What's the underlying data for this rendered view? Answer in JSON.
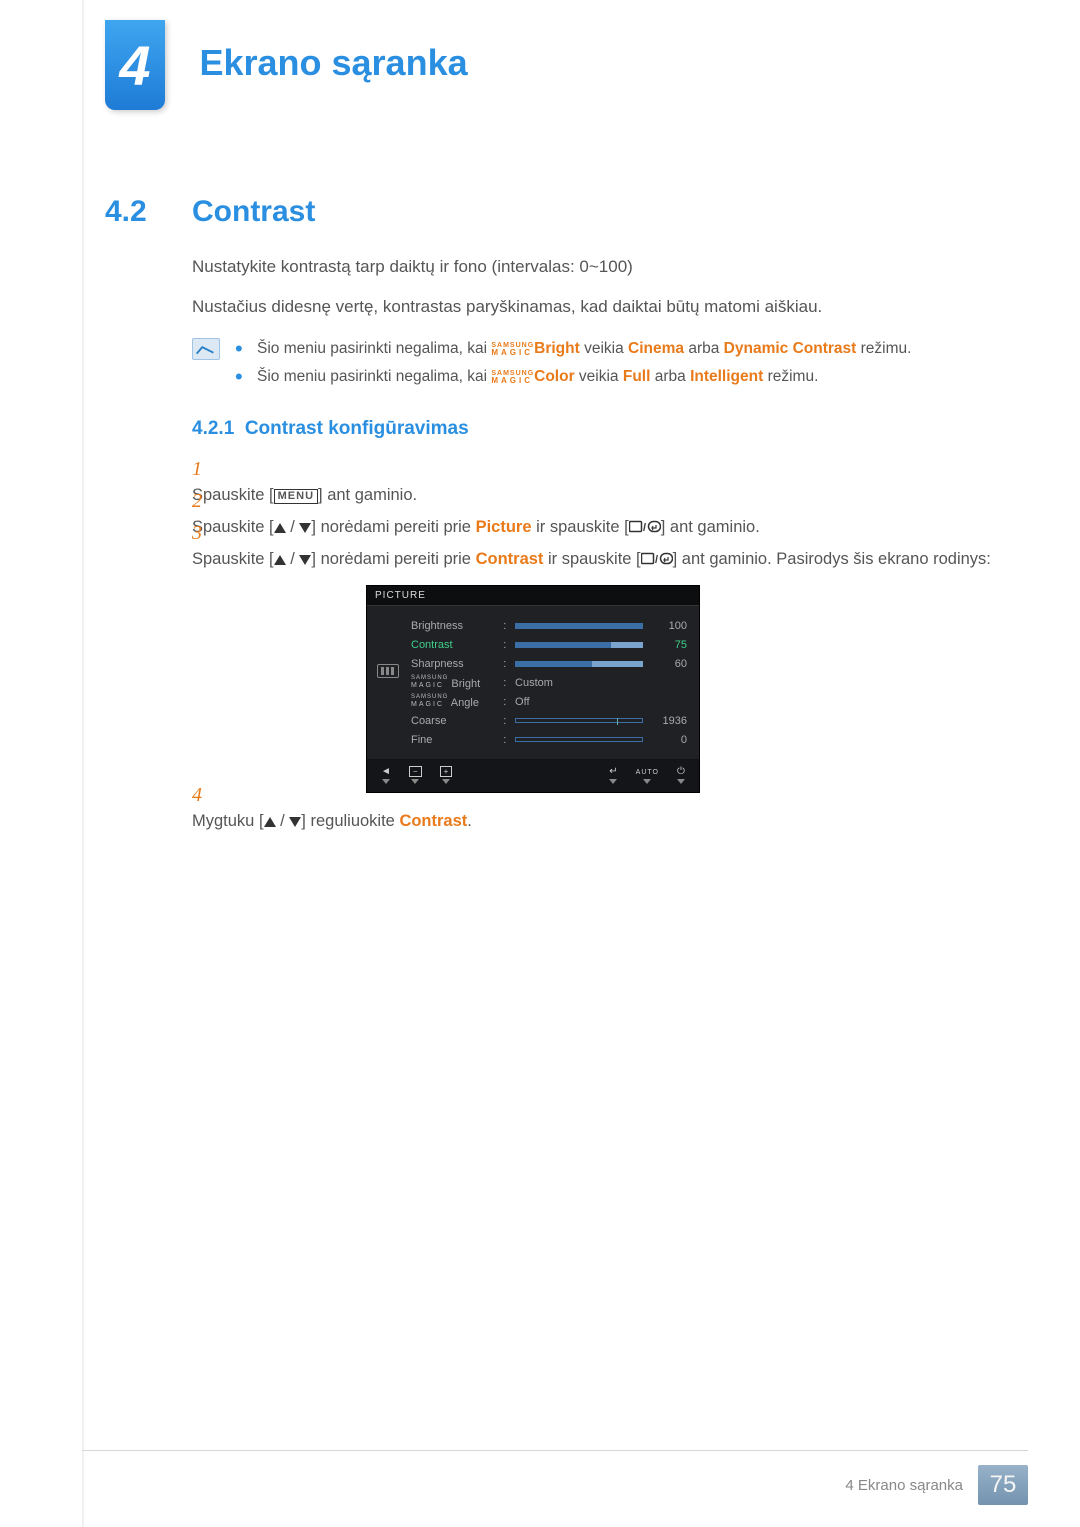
{
  "chapter": {
    "number": "4",
    "title": "Ekrano sąranka"
  },
  "section": {
    "number": "4.2",
    "title": "Contrast",
    "para1": "Nustatykite kontrastą tarp daiktų ir fono (intervalas: 0~100)",
    "para2": "Nustačius didesnę vertę, kontrastas paryškinamas, kad daiktai būtų matomi aiškiau."
  },
  "notes": {
    "magic_tag_top": "SAMSUNG",
    "magic_tag_bot": "MAGIC",
    "line1_a": "Šio meniu pasirinkti negalima, kai ",
    "line1_b": "Bright",
    "line1_c": " veikia ",
    "line1_d": "Cinema",
    "line1_e": " arba ",
    "line1_f": "Dynamic Contrast",
    "line1_g": " režimu.",
    "line2_a": "Šio meniu pasirinkti negalima, kai ",
    "line2_b": "Color",
    "line2_c": " veikia ",
    "line2_d": "Full",
    "line2_e": " arba ",
    "line2_f": "Intelligent",
    "line2_g": " režimu."
  },
  "subsection": {
    "number": "4.2.1",
    "title": "Contrast konfigūravimas"
  },
  "steps": {
    "s1a": "Spauskite [",
    "s1menu": "MENU",
    "s1b": "] ant gaminio.",
    "s2a": "Spauskite [",
    "s2b": "] norėdami pereiti prie ",
    "s2kw": "Picture",
    "s2c": " ir spauskite [",
    "s2d": "] ant gaminio.",
    "s3a": "Spauskite [",
    "s3b": "] norėdami pereiti prie ",
    "s3kw": "Contrast",
    "s3c": " ir spauskite [",
    "s3d": "] ant gaminio. Pasirodys šis ekrano rodinys:",
    "s4a": "Mygtuku [",
    "s4b": "] reguliuokite ",
    "s4kw": "Contrast",
    "s4c": "."
  },
  "osd": {
    "header": "PICTURE",
    "rows": [
      {
        "label": "Brightness",
        "value": "100",
        "bar": 100,
        "type": "bar"
      },
      {
        "label": "Contrast",
        "value": "75",
        "bar": 75,
        "type": "bar",
        "selected": true
      },
      {
        "label": "Sharpness",
        "value": "60",
        "bar": 60,
        "type": "bar"
      },
      {
        "label_magic": "Bright",
        "value": "Custom",
        "type": "text"
      },
      {
        "label_magic": "Angle",
        "value": "Off",
        "type": "text"
      },
      {
        "label": "Coarse",
        "value": "1936",
        "bar": 80,
        "type": "bar-outline"
      },
      {
        "label": "Fine",
        "value": "0",
        "bar": 0,
        "type": "bar-outline"
      }
    ],
    "footer": {
      "auto": "AUTO"
    }
  },
  "footer": {
    "text": "4 Ekrano sąranka",
    "page": "75"
  }
}
